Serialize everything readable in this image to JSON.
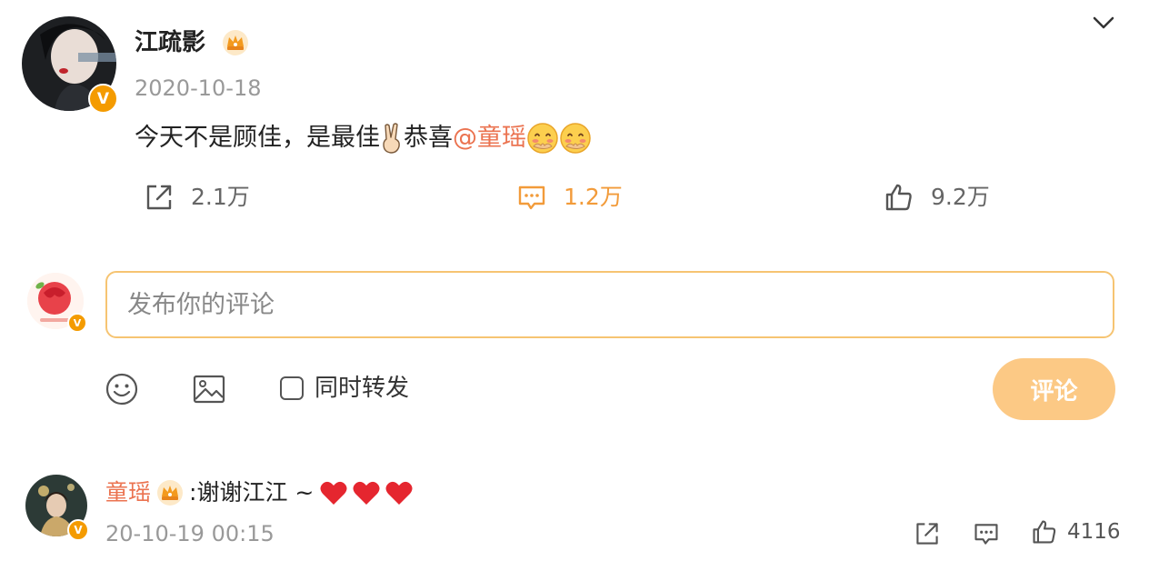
{
  "post": {
    "author": "江疏影",
    "date": "2020-10-18",
    "text_before": "今天不是顾佳，是最佳",
    "text_after": "恭喜",
    "mention": "@童瑶",
    "share_count": "2.1万",
    "comment_count": "1.2万",
    "like_count": "9.2万"
  },
  "composer": {
    "placeholder": "发布你的评论",
    "repost_label": "同时转发",
    "submit_label": "评论"
  },
  "reply": {
    "author": "童瑶",
    "text": ":谢谢江江 ~",
    "time": "20-10-19 00:15",
    "like_count": "4116"
  },
  "icons": {
    "verified": "verified-v-icon",
    "crown": "crown-badge-icon",
    "chevron": "chevron-down-icon",
    "share": "share-icon",
    "comment": "comment-icon",
    "like": "thumbs-up-icon",
    "emoji": "smiley-icon",
    "image": "image-icon",
    "heart": "heart-icon"
  },
  "colors": {
    "accent": "#f29b3a",
    "mention": "#eb7350",
    "verified": "#f49b00",
    "input_border": "#f6c472",
    "submit_bg": "#fcc985"
  }
}
